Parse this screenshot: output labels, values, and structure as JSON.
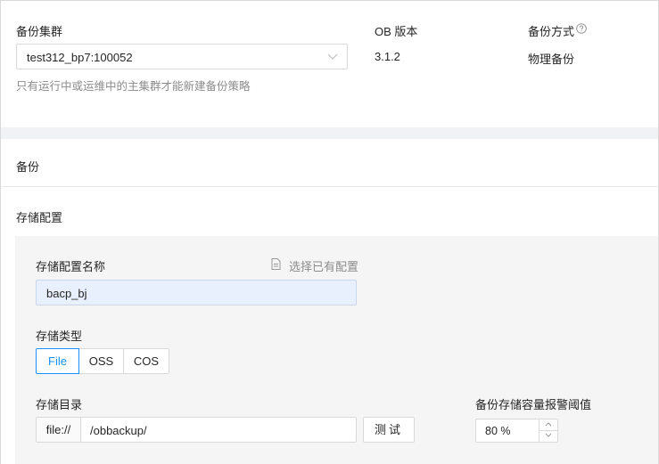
{
  "cluster": {
    "label": "备份集群",
    "selected": "test312_bp7:100052",
    "hint": "只有运行中或运维中的主集群才能新建备份策略"
  },
  "ob_version": {
    "label": "OB 版本",
    "value": "3.1.2"
  },
  "backup_method": {
    "label": "备份方式",
    "value": "物理备份",
    "help_icon": "question-circle-icon"
  },
  "backup_section": {
    "title": "备份"
  },
  "storage": {
    "title": "存储配置",
    "name_label": "存储配置名称",
    "select_existing": "选择已有配置",
    "name_value": "bacp_bj",
    "type_label": "存储类型",
    "types": [
      "File",
      "OSS",
      "COS"
    ],
    "type_selected": "File",
    "dir_label": "存储目录",
    "dir_prefix": "file://",
    "dir_value": "/obbackup/",
    "test_button": "测试",
    "threshold_label": "备份存储容量报警阈值",
    "threshold_value": "80 %"
  },
  "colors": {
    "accent": "#1890ff",
    "section_bg": "#f5f5f5",
    "autofill_bg": "#e8f0fe"
  }
}
